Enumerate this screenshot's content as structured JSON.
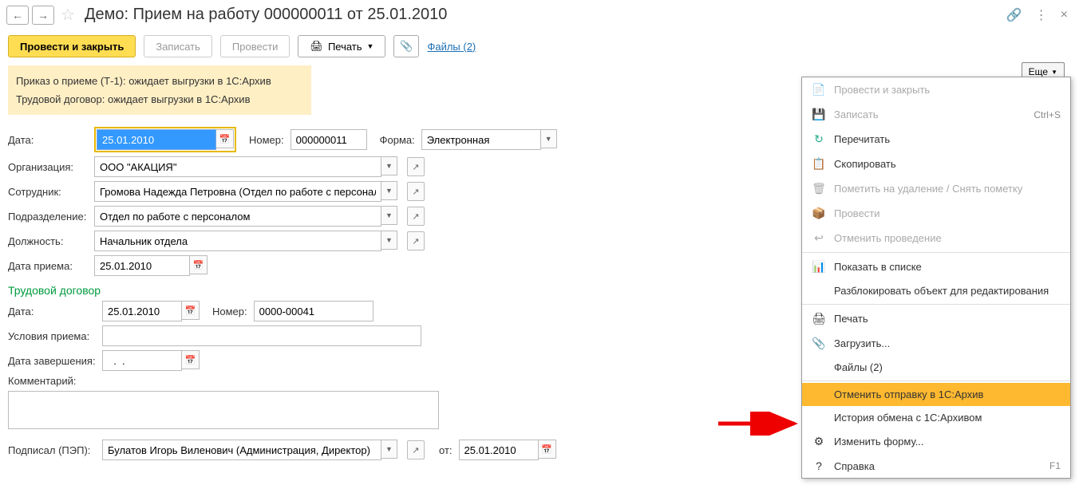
{
  "header": {
    "title": "Демо: Прием на работу 000000011 от 25.01.2010"
  },
  "toolbar": {
    "main": "Провести и закрыть",
    "save": "Записать",
    "post": "Провести",
    "print": "Печать",
    "files": "Файлы (2)",
    "more": "Еще"
  },
  "notice": {
    "l1": "Приказ о приеме (Т-1): ожидает выгрузки в 1С:Архив",
    "l2": "Трудовой договор: ожидает выгрузки в 1С:Архив"
  },
  "labels": {
    "date": "Дата:",
    "number": "Номер:",
    "form": "Форма:",
    "org": "Организация:",
    "emp": "Сотрудник:",
    "dept": "Подразделение:",
    "pos": "Должность:",
    "hiredate": "Дата приема:",
    "contract": "Трудовой договор",
    "cdate": "Дата:",
    "cnum": "Номер:",
    "cond": "Условия приема:",
    "enddate": "Дата завершения:",
    "comment": "Комментарий:",
    "signed": "Подписал (ПЭП):",
    "from": "от:"
  },
  "values": {
    "date": "25.01.2010",
    "number": "000000011",
    "form": "Электронная",
    "org": "ООО \"АКАЦИЯ\"",
    "emp": "Громова Надежда Петровна (Отдел по работе с персоналом",
    "dept": "Отдел по работе с персоналом",
    "pos": "Начальник отдела",
    "hiredate": "25.01.2010",
    "cdate": "25.01.2010",
    "cnum": "0000-00041",
    "cond": "",
    "enddate": "  .  .",
    "comment": "",
    "signed": "Булатов Игорь Виленович (Администрация, Директор)",
    "sdate": "25.01.2010"
  },
  "menu": [
    {
      "icon": "📄",
      "label": "Провести и закрыть",
      "disabled": true
    },
    {
      "icon": "💾",
      "label": "Записать",
      "shortcut": "Ctrl+S",
      "disabled": true
    },
    {
      "icon": "↻",
      "label": "Перечитать",
      "greenIcon": true
    },
    {
      "icon": "📋",
      "label": "Скопировать"
    },
    {
      "icon": "🗑",
      "label": "Пометить на удаление / Снять пометку",
      "disabled": true
    },
    {
      "icon": "📦",
      "label": "Провести",
      "disabled": true
    },
    {
      "icon": "↩",
      "label": "Отменить проведение",
      "disabled": true
    },
    {
      "sep": true
    },
    {
      "icon": "📊",
      "label": "Показать в списке"
    },
    {
      "icon": "",
      "label": "Разблокировать объект для редактирования"
    },
    {
      "sep": true
    },
    {
      "icon": "🖨",
      "label": "Печать"
    },
    {
      "icon": "📎",
      "label": "Загрузить..."
    },
    {
      "icon": "",
      "label": "Файлы (2)"
    },
    {
      "sep": true
    },
    {
      "icon": "",
      "label": "Отменить отправку в 1С:Архив",
      "highlighted": true
    },
    {
      "icon": "",
      "label": "История обмена с 1С:Архивом"
    },
    {
      "icon": "⚙",
      "label": "Изменить форму..."
    },
    {
      "icon": "?",
      "label": "Справка",
      "shortcut": "F1"
    }
  ]
}
